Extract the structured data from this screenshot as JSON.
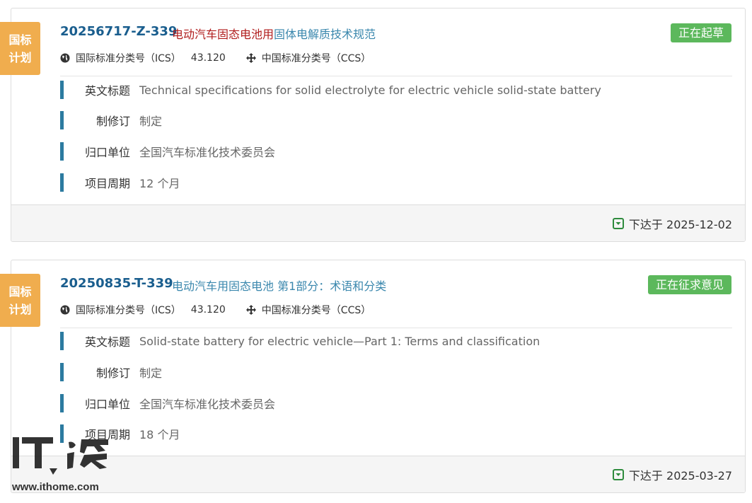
{
  "items": [
    {
      "ribbon": [
        "国标",
        "计划"
      ],
      "number": "20256717-Z-339",
      "title_part1": "电动汽车固态电池用",
      "title_part2": "固体电解质技术规范",
      "status": "正在起草",
      "ics_label": "国际标准分类号（ICS）",
      "ics_value": "43.120",
      "ccs_label": "中国标准分类号（CCS）",
      "fields": [
        {
          "label": "英文标题",
          "value": "Technical specifications for solid electrolyte for electric vehicle solid-state battery"
        },
        {
          "label": "制修订",
          "value": "制定"
        },
        {
          "label": "归口单位",
          "value": "全国汽车标准化技术委员会"
        },
        {
          "label": "项目周期",
          "value": "12 个月"
        }
      ],
      "issued": "下达于 2025-12-02"
    },
    {
      "ribbon": [
        "国标",
        "计划"
      ],
      "number": "20250835-T-339",
      "title_part1": "",
      "title_part2": "电动汽车用固态电池 第1部分：术语和分类",
      "status": "正在征求意见",
      "ics_label": "国际标准分类号（ICS）",
      "ics_value": "43.120",
      "ccs_label": "中国标准分类号（CCS）",
      "fields": [
        {
          "label": "英文标题",
          "value": "Solid-state battery for electric vehicle—Part 1: Terms and classification"
        },
        {
          "label": "制修订",
          "value": "制定"
        },
        {
          "label": "归口单位",
          "value": "全国汽车标准化技术委员会"
        },
        {
          "label": "项目周期",
          "value": "18 个月"
        }
      ],
      "issued": "下达于 2025-03-27"
    }
  ],
  "watermark": {
    "logo": "IT之家",
    "url": "www.ithome.com"
  },
  "colors": {
    "ribbon": "#f0ad4e",
    "status": "#5cb85c",
    "number": "#1a5e8e",
    "title_red": "#b01c1c",
    "title_blue": "#3a87ad",
    "field_bar": "#2c7ba0"
  }
}
